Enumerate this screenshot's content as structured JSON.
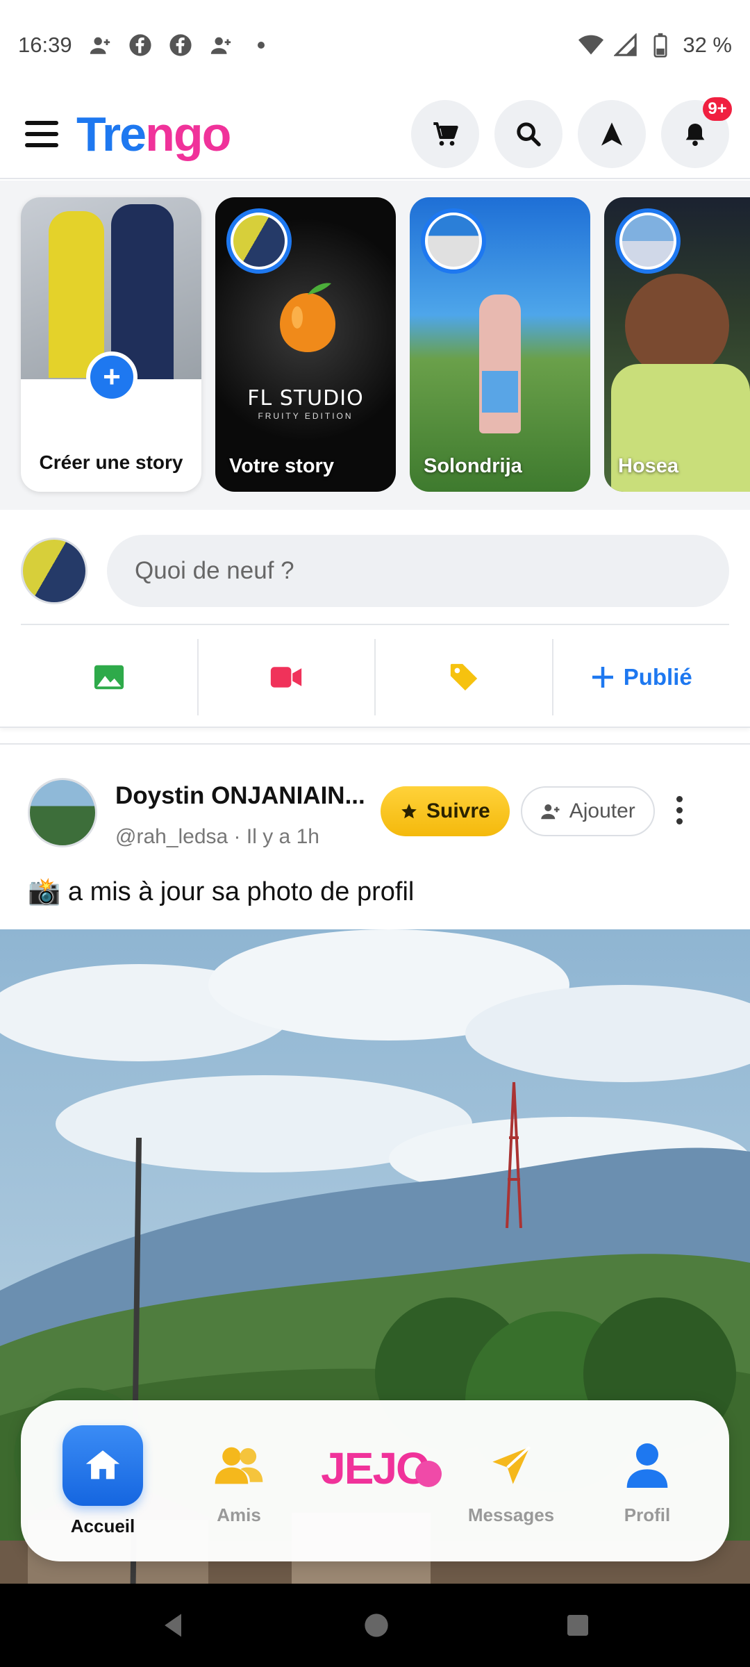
{
  "status_bar": {
    "time": "16:39",
    "battery": "32 %"
  },
  "header": {
    "logo_part1": "Tre",
    "logo_part2": "ngo",
    "notification_badge": "9+"
  },
  "stories": [
    {
      "name": "Créer une story"
    },
    {
      "name": "Votre story"
    },
    {
      "name": "Solondrija"
    },
    {
      "name": "Hosea"
    }
  ],
  "composer": {
    "placeholder": "Quoi de neuf ?",
    "publish_label": "Publié"
  },
  "post": {
    "author": "Doystin ONJANIAIN...",
    "handle": "@rah_ledsa · Il y a 1h",
    "follow_label": "Suivre",
    "add_label": "Ajouter",
    "text": "📸 a mis à jour sa photo de profil"
  },
  "bottom_nav": {
    "home": "Accueil",
    "friends": "Amis",
    "jejo": "JEJO",
    "messages": "Messages",
    "profile": "Profil"
  },
  "colors": {
    "brand_blue": "#1e78f0",
    "brand_pink": "#f0329a",
    "follow_yellow": "#f4b90c",
    "badge_red": "#f02040"
  }
}
